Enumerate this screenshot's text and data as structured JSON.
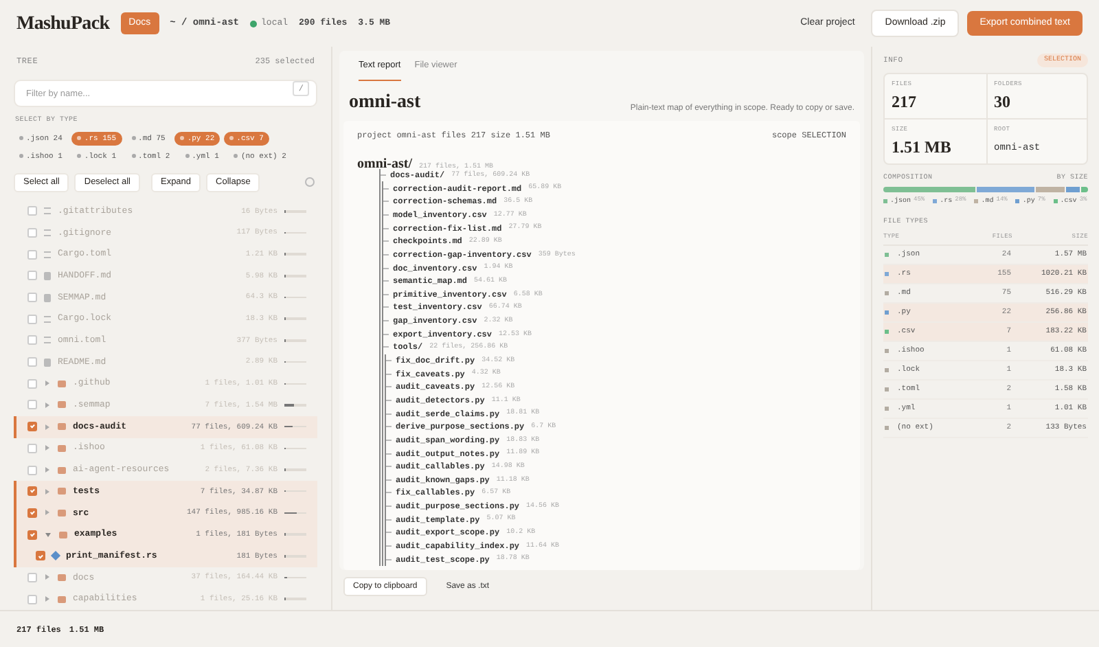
{
  "header": {
    "logo": "MashuPack",
    "badge": "Docs",
    "path": "~ / omni-ast",
    "source": "local",
    "files": "290 files",
    "size": "3.5 MB",
    "actions": [
      {
        "label": "Clear project",
        "kind": "plain"
      },
      {
        "label": "Download .zip",
        "kind": "outline"
      },
      {
        "label": "Export combined text",
        "kind": "primary"
      }
    ]
  },
  "tree_panel": {
    "title": "TREE",
    "selected_count": "235 selected",
    "filter": {
      "placeholder": "Filter by name...",
      "shortcut": "/"
    },
    "types_label": "SELECT BY TYPE",
    "type_chips": [
      {
        "label": ".json 24",
        "selected": false
      },
      {
        "label": ".rs 155",
        "selected": true
      },
      {
        "label": ".md 75",
        "selected": false
      },
      {
        "label": ".py 22",
        "selected": true
      },
      {
        "label": ".csv 7",
        "selected": true
      },
      {
        "label": ".ishoo 1",
        "selected": false
      },
      {
        "label": ".lock 1",
        "selected": false
      },
      {
        "label": ".toml 2",
        "selected": false
      },
      {
        "label": ".yml 1",
        "selected": false
      },
      {
        "label": "(no ext) 2",
        "selected": false
      }
    ],
    "buttons": [
      "Select all",
      "Deselect all",
      "Expand",
      "Collapse"
    ],
    "rows": [
      {
        "kind": "file",
        "name": ".gitattributes",
        "meta": "16 Bytes",
        "checked": false,
        "level": 0.01
      },
      {
        "kind": "file",
        "name": ".gitignore",
        "meta": "117 Bytes",
        "checked": false,
        "level": 0.01
      },
      {
        "kind": "file",
        "name": "Cargo.toml",
        "meta": "1.21 KB",
        "checked": false,
        "level": 0.01
      },
      {
        "kind": "doc",
        "name": "HANDOFF.md",
        "meta": "5.98 KB",
        "checked": false,
        "level": 0.01
      },
      {
        "kind": "doc",
        "name": "SEMMAP.md",
        "meta": "64.3 KB",
        "checked": false,
        "level": 0.05
      },
      {
        "kind": "file",
        "name": "Cargo.lock",
        "meta": "18.3 KB",
        "checked": false,
        "level": 0.01
      },
      {
        "kind": "file",
        "name": "omni.toml",
        "meta": "377 Bytes",
        "checked": false,
        "level": 0.01
      },
      {
        "kind": "doc",
        "name": "README.md",
        "meta": "2.89 KB",
        "checked": false,
        "level": 0.01
      },
      {
        "kind": "folder",
        "name": ".github",
        "meta": "1 files, 1.01 KB",
        "checked": false,
        "expanded": false,
        "level": 0.01
      },
      {
        "kind": "folder",
        "name": ".semmap",
        "meta": "7 files, 1.54 MB",
        "checked": false,
        "expanded": false,
        "level": 0.45
      },
      {
        "kind": "folder",
        "name": "docs-audit",
        "meta": "77 files, 609.24 KB",
        "checked": true,
        "expanded": false,
        "level": 0.4
      },
      {
        "kind": "folder",
        "name": ".ishoo",
        "meta": "1 files, 61.08 KB",
        "checked": false,
        "expanded": false,
        "level": 0.05
      },
      {
        "kind": "folder",
        "name": "ai-agent-resources",
        "meta": "2 files, 7.36 KB",
        "checked": false,
        "expanded": false,
        "level": 0.01
      },
      {
        "kind": "folder",
        "name": "tests",
        "meta": "7 files, 34.87 KB",
        "checked": true,
        "expanded": false,
        "level": 0.05
      },
      {
        "kind": "folder",
        "name": "src",
        "meta": "147 files, 985.16 KB",
        "checked": true,
        "expanded": false,
        "level": 0.55
      },
      {
        "kind": "folder",
        "name": "examples",
        "meta": "1 files, 181 Bytes",
        "checked": true,
        "expanded": true,
        "level": 0.01
      },
      {
        "kind": "source",
        "name": "print_manifest.rs",
        "meta": "181 Bytes",
        "checked": true,
        "level": 0.01
      },
      {
        "kind": "folder",
        "name": "docs",
        "meta": "37 files, 164.44 KB",
        "checked": false,
        "expanded": false,
        "level": 0.12
      },
      {
        "kind": "folder",
        "name": "capabilities",
        "meta": "1 files, 25.16 KB",
        "checked": false,
        "expanded": false,
        "level": 0.02
      }
    ]
  },
  "report": {
    "tabs": [
      {
        "label": "Text report",
        "selected": true
      },
      {
        "label": "File viewer",
        "selected": false
      }
    ],
    "title": "omni-ast",
    "description": "Plain-text map of everything in scope. Ready to copy or save.",
    "summary": "project omni-ast files 217 size 1.51 MB",
    "scope": "scope SELECTION",
    "tree": {
      "name": "omni-ast/",
      "meta": "217 files, 1.51 MB",
      "children": [
        {
          "name": "docs-audit/",
          "meta": "77 files, 609.24 KB",
          "children": [
            {
              "name": "correction-audit-report.md",
              "meta": "65.89 KB"
            },
            {
              "name": "correction-schemas.md",
              "meta": "36.5 KB"
            },
            {
              "name": "model_inventory.csv",
              "meta": "12.77 KB"
            },
            {
              "name": "correction-fix-list.md",
              "meta": "27.79 KB"
            },
            {
              "name": "checkpoints.md",
              "meta": "22.89 KB"
            },
            {
              "name": "correction-gap-inventory.csv",
              "meta": "359 Bytes"
            },
            {
              "name": "doc_inventory.csv",
              "meta": "1.94 KB"
            },
            {
              "name": "semantic_map.md",
              "meta": "54.61 KB"
            },
            {
              "name": "primitive_inventory.csv",
              "meta": "6.58 KB"
            },
            {
              "name": "test_inventory.csv",
              "meta": "66.74 KB"
            },
            {
              "name": "gap_inventory.csv",
              "meta": "2.32 KB"
            },
            {
              "name": "export_inventory.csv",
              "meta": "12.53 KB"
            },
            {
              "name": "tools/",
              "meta": "22 files, 256.86 KB",
              "children": [
                {
                  "name": "fix_doc_drift.py",
                  "meta": "34.52 KB"
                },
                {
                  "name": "fix_caveats.py",
                  "meta": "4.32 KB"
                },
                {
                  "name": "audit_caveats.py",
                  "meta": "12.56 KB"
                },
                {
                  "name": "audit_detectors.py",
                  "meta": "11.1 KB"
                },
                {
                  "name": "audit_serde_claims.py",
                  "meta": "18.81 KB"
                },
                {
                  "name": "derive_purpose_sections.py",
                  "meta": "6.7 KB"
                },
                {
                  "name": "audit_span_wording.py",
                  "meta": "18.83 KB"
                },
                {
                  "name": "audit_output_notes.py",
                  "meta": "11.89 KB"
                },
                {
                  "name": "audit_callables.py",
                  "meta": "14.98 KB"
                },
                {
                  "name": "audit_known_gaps.py",
                  "meta": "11.18 KB"
                },
                {
                  "name": "fix_callables.py",
                  "meta": "6.57 KB"
                },
                {
                  "name": "audit_purpose_sections.py",
                  "meta": "14.56 KB"
                },
                {
                  "name": "audit_template.py",
                  "meta": "5.07 KB"
                },
                {
                  "name": "audit_export_scope.py",
                  "meta": "10.2 KB"
                },
                {
                  "name": "audit_capability_index.py",
                  "meta": "11.64 KB"
                },
                {
                  "name": "audit_test_scope.py",
                  "meta": "18.78 KB"
                }
              ]
            }
          ]
        }
      ]
    },
    "buttons": [
      {
        "label": "Copy to clipboard",
        "kind": "outline"
      },
      {
        "label": "Save as .txt",
        "kind": "plain"
      }
    ]
  },
  "info": {
    "title": "INFO",
    "badge": "SELECTION",
    "stats": [
      {
        "label": "FILES",
        "value": "217",
        "kind": "number"
      },
      {
        "label": "FOLDERS",
        "value": "30",
        "kind": "number"
      },
      {
        "label": "SIZE",
        "value": "1.51 MB",
        "kind": "number"
      },
      {
        "label": "ROOT",
        "value": "omni-ast",
        "kind": "code"
      }
    ],
    "composition": {
      "title": "COMPOSITION",
      "mode": "BY SIZE",
      "segments": [
        {
          "label": ".json",
          "share": "45%",
          "color": "#7fbf94"
        },
        {
          "label": ".rs",
          "share": "28%",
          "color": "#7fa9d6"
        },
        {
          "label": ".md",
          "share": "14%",
          "color": "#bfb3a3"
        },
        {
          "label": ".py",
          "share": "7%",
          "color": "#6f9fd0"
        },
        {
          "label": ".csv",
          "share": "3%",
          "color": "#6cbf8a"
        }
      ]
    },
    "file_types": {
      "title": "FILE TYPES",
      "columns": [
        "TYPE",
        "FILES",
        "SIZE"
      ],
      "rows": [
        {
          "type": ".json",
          "files": "24",
          "size": "1.57 MB",
          "color": "#7fbf94",
          "selected": false
        },
        {
          "type": ".rs",
          "files": "155",
          "size": "1020.21 KB",
          "color": "#7fa9d6",
          "selected": true
        },
        {
          "type": ".md",
          "files": "75",
          "size": "516.29 KB",
          "color": "#b3aca2",
          "selected": false
        },
        {
          "type": ".py",
          "files": "22",
          "size": "256.86 KB",
          "color": "#6f9fd0",
          "selected": true
        },
        {
          "type": ".csv",
          "files": "7",
          "size": "183.22 KB",
          "color": "#6cbf8a",
          "selected": true
        },
        {
          "type": ".ishoo",
          "files": "1",
          "size": "61.08 KB",
          "color": "#b3aca2",
          "selected": false
        },
        {
          "type": ".lock",
          "files": "1",
          "size": "18.3 KB",
          "color": "#b3aca2",
          "selected": false
        },
        {
          "type": ".toml",
          "files": "2",
          "size": "1.58 KB",
          "color": "#b3aca2",
          "selected": false
        },
        {
          "type": ".yml",
          "files": "1",
          "size": "1.01 KB",
          "color": "#b3aca2",
          "selected": false
        },
        {
          "type": "(no ext)",
          "files": "2",
          "size": "133 Bytes",
          "color": "#b3aca2",
          "selected": false
        }
      ]
    }
  },
  "status_bar": {
    "files": "217 files",
    "size": "1.51 MB"
  }
}
